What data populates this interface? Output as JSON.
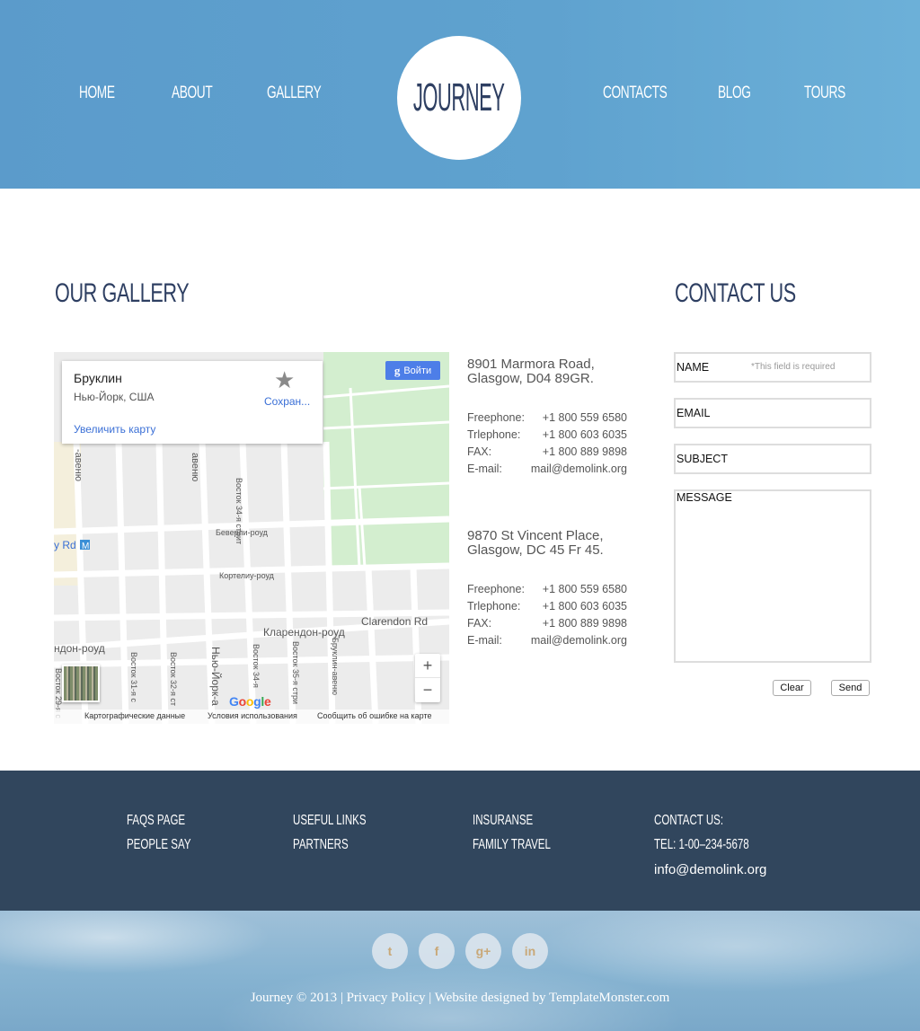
{
  "nav": {
    "home": "HOME",
    "about": "ABOUT",
    "gallery": "GALLERY",
    "contacts": "CONTACTS",
    "blog": "BLOG",
    "tours": "TOURS"
  },
  "logo": "JOURNEY",
  "gallery_title": "OUR GALLERY",
  "contact_title": "CONTACT US",
  "map": {
    "place": "Бруклин",
    "place_sub": "Нью-Йорк, США",
    "enlarge": "Увеличить карту",
    "save": "Сохран...",
    "signin": "Войти",
    "signin_g": "g",
    "zoom_in": "+",
    "zoom_out": "−",
    "footer_data": "Картографические данные",
    "footer_terms": "Условия использования",
    "footer_report": "Сообщить об ошибке на карте",
    "streets": {
      "beverly": "Беверли-роуд",
      "cortelyou": "Кортелиу-роуд",
      "clarendon_ru": "Кларендон-роуд",
      "clarendon_en": "Clarendon Rd",
      "east34": "Восток 34-я стрит",
      "east34b": "Восток 34-я",
      "east35": "Восток 35-я стри",
      "east31": "Восток 31-я с",
      "east32": "Восток 32-я ст",
      "east29": "Восток 29-я с",
      "newyork": "Нью-Йорк-а",
      "brooklyn": "Бруклин-авеню",
      "avenue1": "авеню",
      "avenue2": "-авеню",
      "road_left": "ндон-роуд",
      "ry_rd": "y Rd",
      "metro": "M"
    }
  },
  "addresses": [
    {
      "line1": "8901 Marmora Road,",
      "line2": "Glasgow, D04 89GR.",
      "rows": [
        {
          "label": "Freephone:",
          "value": "+1 800 559 6580"
        },
        {
          "label": "Trlephone:",
          "value": "+1 800 603 6035"
        },
        {
          "label": "FAX:",
          "value": "+1 800 889 9898"
        },
        {
          "label": "E-mail:",
          "value": "mail@demolink.org"
        }
      ]
    },
    {
      "line1": "9870 St Vincent Place,",
      "line2": "Glasgow, DC 45 Fr 45.",
      "rows": [
        {
          "label": "Freephone:",
          "value": "+1 800 559 6580"
        },
        {
          "label": "Trlephone:",
          "value": "+1 800 603 6035"
        },
        {
          "label": "FAX:",
          "value": "+1 800 889 9898"
        },
        {
          "label": "E-mail:",
          "value": "mail@demolink.org"
        }
      ]
    }
  ],
  "form": {
    "name": "NAME",
    "required": "*This field is required",
    "email": "EMAIL",
    "subject": "SUBJECT",
    "message": "MESSAGE",
    "clear": "Clear",
    "send": "Send"
  },
  "footer": {
    "faqs": "FAQS PAGE",
    "people_say": "PEOPLE SAY",
    "useful_links": "USEFUL LINKS",
    "partners": "PARTNERS",
    "insurance": "INSURANSE",
    "family_travel": "FAMILY TRAVEL",
    "contact_us": "CONTACT US:",
    "tel": "TEL: 1-00–234-5678",
    "email": "info@demolink.org"
  },
  "social": {
    "twitter": "t",
    "facebook": "f",
    "google_plus": "g+",
    "linkedin": "in"
  },
  "copyright": "Journey © 2013 | Privacy Policy | Website designed by TemplateMonster.com",
  "colors": {
    "header": "#5b9bcb",
    "title": "#2e3f62",
    "footer": "#31465d",
    "link_blue": "#3a6fd6"
  }
}
